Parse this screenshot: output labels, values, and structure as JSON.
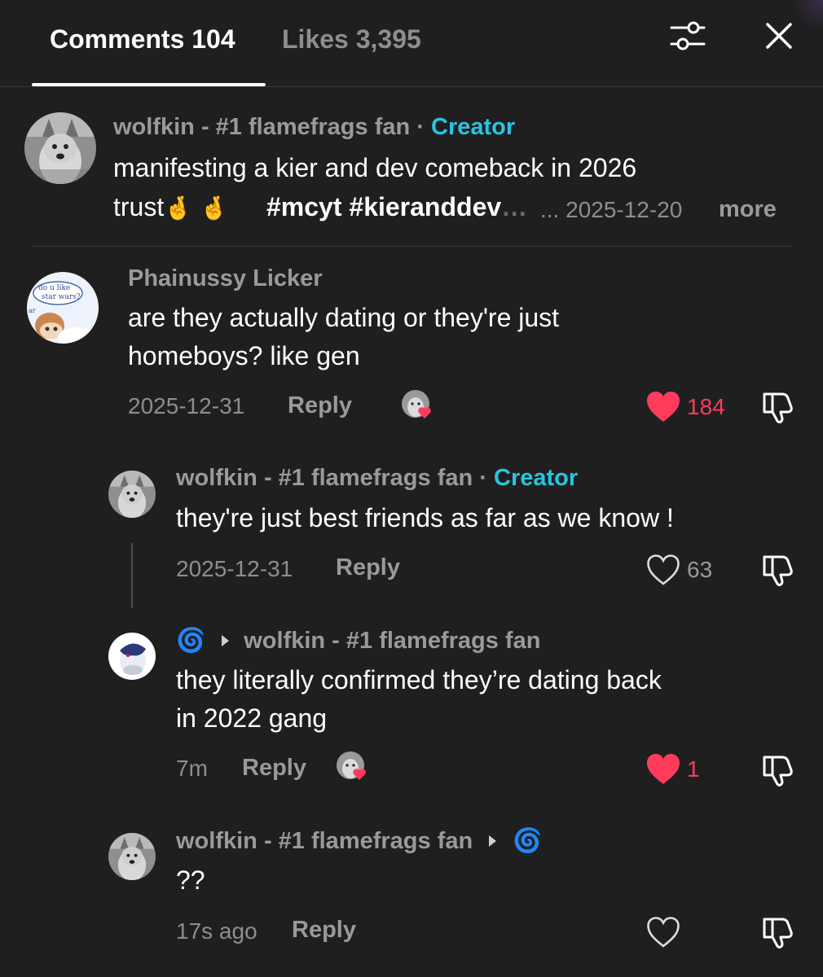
{
  "tabs": {
    "comments_label": "Comments 104",
    "likes_label": "Likes 3,395"
  },
  "icons": {
    "filter": "filter-sliders-icon",
    "close": "close-icon",
    "like_filled": "heart-filled-icon",
    "like_outline": "heart-outline-icon",
    "dislike": "thumbs-down-icon",
    "creator_liked": "creator-liked-heart-icon",
    "reply_arrow": "reply-arrow-icon",
    "swirl": "swirl-emoji-icon",
    "fingers_crossed": "crossed-fingers-emoji"
  },
  "colors": {
    "background": "#1f1f1f",
    "creator_tag": "#2ac4e0",
    "liked_red": "#ff3b5c",
    "muted": "#9a9a9a"
  },
  "pinned": {
    "username": "wolfkin - #1 flamefrags fan",
    "separator": "·",
    "creator_tag": "Creator",
    "text_line1": "manifesting a kier and dev comeback in 2026",
    "text_trust": "trust",
    "emoji1": "🤞",
    "emoji2": "🤞",
    "hashtags": "#mcyt #kieranddev",
    "hashtag_fade": "…",
    "ellipsis": "...",
    "date": "2025-12-20",
    "more_label": "more"
  },
  "comment1": {
    "username": "Phainussy Licker",
    "avatar_text_1": "do u like",
    "avatar_text_2": "star wars?",
    "avatar_text_3": "ar",
    "text_line1": "are they actually dating or they're just",
    "text_line2": "homeboys? like gen",
    "date": "2025-12-31",
    "reply_label": "Reply",
    "likes": "184"
  },
  "reply1": {
    "username": "wolfkin - #1 flamefrags fan",
    "separator": "·",
    "creator_tag": "Creator",
    "text": "they're just best friends as far as we know !",
    "date": "2025-12-31",
    "reply_label": "Reply",
    "likes": "63"
  },
  "reply2": {
    "swirl_emoji": "🌀",
    "reply_to": "wolfkin - #1 flamefrags fan",
    "text_line1": "they literally confirmed they’re dating back",
    "text_line2": "in 2022 gang",
    "time": "7m",
    "reply_label": "Reply",
    "likes": "1"
  },
  "reply3": {
    "username": "wolfkin - #1 flamefrags fan",
    "swirl_emoji": "🌀",
    "text": "??",
    "time": "17s ago",
    "reply_label": "Reply"
  }
}
